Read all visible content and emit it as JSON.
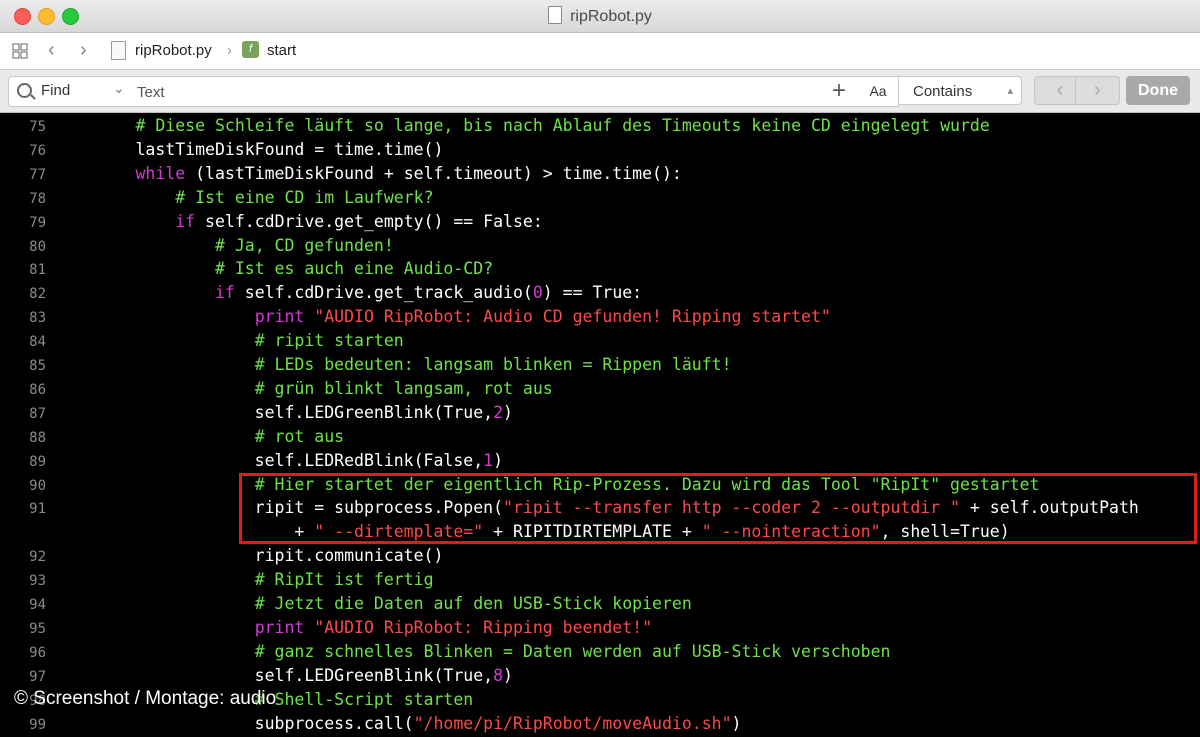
{
  "window": {
    "title": "ripRobot.py"
  },
  "pathbar": {
    "file": "ripRobot.py",
    "function": "start"
  },
  "findbar": {
    "mode": "Find",
    "placeholder": "Text",
    "case": "Aa",
    "match": "Contains",
    "done": "Done"
  },
  "credit": "© Screenshot / Montage: audio",
  "lines": [
    {
      "n": "75",
      "segs": [
        {
          "t": "        ",
          "k": ""
        },
        {
          "t": "# Diese Schleife läuft so lange, bis nach Ablauf des Timeouts keine CD eingelegt wurde",
          "k": "c"
        }
      ]
    },
    {
      "n": "76",
      "segs": [
        {
          "t": "        lastTimeDiskFound = time.time()",
          "k": ""
        }
      ]
    },
    {
      "n": "77",
      "segs": [
        {
          "t": "        ",
          "k": ""
        },
        {
          "t": "while",
          "k": "k"
        },
        {
          "t": " (lastTimeDiskFound + self.timeout) > time.time():",
          "k": ""
        }
      ]
    },
    {
      "n": "78",
      "segs": [
        {
          "t": "            ",
          "k": ""
        },
        {
          "t": "# Ist eine CD im Laufwerk?",
          "k": "c"
        }
      ]
    },
    {
      "n": "79",
      "segs": [
        {
          "t": "            ",
          "k": ""
        },
        {
          "t": "if",
          "k": "k"
        },
        {
          "t": " self.cdDrive.get_empty() == False:",
          "k": ""
        }
      ]
    },
    {
      "n": "80",
      "segs": [
        {
          "t": "                ",
          "k": ""
        },
        {
          "t": "# Ja, CD gefunden!",
          "k": "c"
        }
      ]
    },
    {
      "n": "81",
      "segs": [
        {
          "t": "                ",
          "k": ""
        },
        {
          "t": "# Ist es auch eine Audio-CD?",
          "k": "c"
        }
      ]
    },
    {
      "n": "82",
      "segs": [
        {
          "t": "                ",
          "k": ""
        },
        {
          "t": "if",
          "k": "k"
        },
        {
          "t": " self.cdDrive.get_track_audio(",
          "k": ""
        },
        {
          "t": "0",
          "k": "n"
        },
        {
          "t": ") == True:",
          "k": ""
        }
      ]
    },
    {
      "n": "83",
      "segs": [
        {
          "t": "                    ",
          "k": ""
        },
        {
          "t": "print",
          "k": "k"
        },
        {
          "t": " ",
          "k": ""
        },
        {
          "t": "\"AUDIO RipRobot: Audio CD gefunden! Ripping startet\"",
          "k": "s"
        }
      ]
    },
    {
      "n": "84",
      "segs": [
        {
          "t": "                    ",
          "k": ""
        },
        {
          "t": "# ripit starten",
          "k": "c"
        }
      ]
    },
    {
      "n": "85",
      "segs": [
        {
          "t": "                    ",
          "k": ""
        },
        {
          "t": "# LEDs bedeuten: langsam blinken = Rippen läuft!",
          "k": "c"
        }
      ]
    },
    {
      "n": "86",
      "segs": [
        {
          "t": "                    ",
          "k": ""
        },
        {
          "t": "# grün blinkt langsam, rot aus",
          "k": "c"
        }
      ]
    },
    {
      "n": "87",
      "segs": [
        {
          "t": "                    self.LEDGreenBlink(True,",
          "k": ""
        },
        {
          "t": "2",
          "k": "n"
        },
        {
          "t": ")",
          "k": ""
        }
      ]
    },
    {
      "n": "88",
      "segs": [
        {
          "t": "                    ",
          "k": ""
        },
        {
          "t": "# rot aus",
          "k": "c"
        }
      ]
    },
    {
      "n": "89",
      "segs": [
        {
          "t": "                    self.LEDRedBlink(False,",
          "k": ""
        },
        {
          "t": "1",
          "k": "n"
        },
        {
          "t": ")",
          "k": ""
        }
      ]
    },
    {
      "n": "90",
      "segs": [
        {
          "t": "                    ",
          "k": ""
        },
        {
          "t": "# Hier startet der eigentlich Rip-Prozess. Dazu wird das Tool \"RipIt\" gestartet",
          "k": "c"
        }
      ]
    },
    {
      "n": "91",
      "segs": [
        {
          "t": "                    ripit = subprocess.Popen(",
          "k": ""
        },
        {
          "t": "\"ripit --transfer http --coder 2 --outputdir \"",
          "k": "s"
        },
        {
          "t": " + self.outputPath",
          "k": ""
        }
      ]
    },
    {
      "n": "",
      "segs": [
        {
          "t": "                        + ",
          "k": ""
        },
        {
          "t": "\" --dirtemplate=\"",
          "k": "s"
        },
        {
          "t": " + RIPITDIRTEMPLATE + ",
          "k": ""
        },
        {
          "t": "\" --nointeraction\"",
          "k": "s"
        },
        {
          "t": ", shell=True)",
          "k": ""
        }
      ]
    },
    {
      "n": "92",
      "segs": [
        {
          "t": "                    ripit.communicate()",
          "k": ""
        }
      ]
    },
    {
      "n": "93",
      "segs": [
        {
          "t": "                    ",
          "k": ""
        },
        {
          "t": "# RipIt ist fertig",
          "k": "c"
        }
      ]
    },
    {
      "n": "94",
      "segs": [
        {
          "t": "                    ",
          "k": ""
        },
        {
          "t": "# Jetzt die Daten auf den USB-Stick kopieren",
          "k": "c"
        }
      ]
    },
    {
      "n": "95",
      "segs": [
        {
          "t": "                    ",
          "k": ""
        },
        {
          "t": "print",
          "k": "k"
        },
        {
          "t": " ",
          "k": ""
        },
        {
          "t": "\"AUDIO RipRobot: Ripping beendet!\"",
          "k": "s"
        }
      ]
    },
    {
      "n": "96",
      "segs": [
        {
          "t": "                    ",
          "k": ""
        },
        {
          "t": "# ganz schnelles Blinken = Daten werden auf USB-Stick verschoben",
          "k": "c"
        }
      ]
    },
    {
      "n": "97",
      "segs": [
        {
          "t": "                    self.LEDGreenBlink(True,",
          "k": ""
        },
        {
          "t": "8",
          "k": "n"
        },
        {
          "t": ")",
          "k": ""
        }
      ]
    },
    {
      "n": "98",
      "segs": [
        {
          "t": "                    ",
          "k": ""
        },
        {
          "t": "# Shell-Script starten",
          "k": "c"
        }
      ]
    },
    {
      "n": "99",
      "segs": [
        {
          "t": "                    subprocess.call(",
          "k": ""
        },
        {
          "t": "\"/home/pi/RipRobot/moveAudio.sh\"",
          "k": "s"
        },
        {
          "t": ")",
          "k": ""
        }
      ]
    }
  ]
}
